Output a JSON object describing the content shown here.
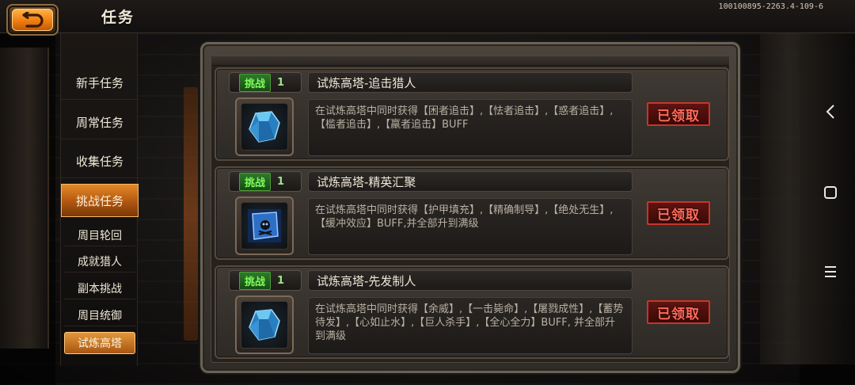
{
  "header": {
    "title": "任务",
    "build_id": "100100895-2263.4-109-6",
    "back_icon": "return-arrow-icon"
  },
  "colors": {
    "accent_orange": "#f08a20",
    "tag_green": "#7dff5a",
    "claimed_red": "#ff6a5a"
  },
  "sidebar": {
    "main_items": [
      {
        "label": "新手任务",
        "active": false
      },
      {
        "label": "周常任务",
        "active": false
      },
      {
        "label": "收集任务",
        "active": false
      },
      {
        "label": "挑战任务",
        "active": true
      }
    ],
    "sub_items": [
      {
        "label": "周目轮回",
        "active": false
      },
      {
        "label": "成就猎人",
        "active": false
      },
      {
        "label": "副本挑战",
        "active": false
      },
      {
        "label": "周目统御",
        "active": false
      },
      {
        "label": "试炼高塔",
        "active": true
      }
    ]
  },
  "tasks": [
    {
      "tag": "挑战",
      "count": "1",
      "title": "试炼高塔-追击猎人",
      "description": "在试炼高塔中同时获得【困者追击】,【怯者追击】,【惑者追击】,【槛者追击】,【羸者追击】BUFF",
      "icon": "blue-gem-icon",
      "status": "已领取"
    },
    {
      "tag": "挑战",
      "count": "1",
      "title": "试炼高塔-精英汇聚",
      "description": "在试炼高塔中同时获得【护甲填充】,【精确制导】,【绝处无生】,【缓冲效应】BUFF,并全部升到满级",
      "icon": "scroll-skull-icon",
      "status": "已领取"
    },
    {
      "tag": "挑战",
      "count": "1",
      "title": "试炼高塔-先发制人",
      "description": "在试炼高塔中同时获得【余威】,【一击毙命】,【屠戮成性】,【蓄势待发】,【心如止水】,【巨人杀手】,【全心全力】BUFF, 并全部升到满级",
      "icon": "blue-gem-icon",
      "status": "已领取"
    }
  ],
  "system_nav": {
    "back_icon": "nav-back-chevron-icon",
    "home_icon": "nav-home-square-icon",
    "menu_icon": "nav-menu-lines-icon"
  }
}
